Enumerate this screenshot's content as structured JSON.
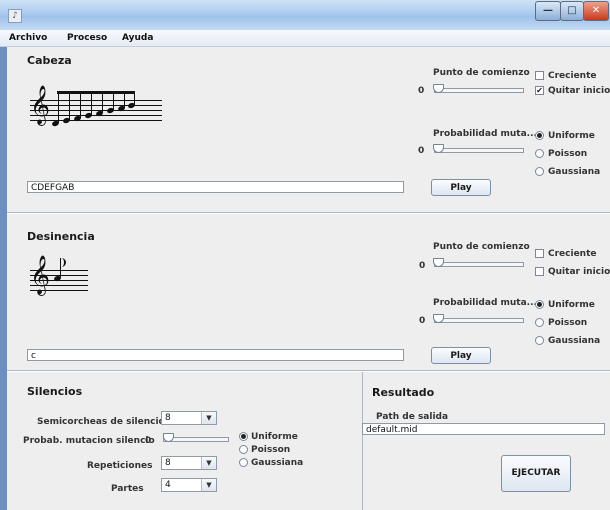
{
  "window": {
    "minimize": "—",
    "maximize": "□",
    "close": "✕",
    "app_icon": "window-app-icon"
  },
  "menu": [
    "Archivo",
    "Proceso",
    "Ayuda"
  ],
  "cabeza": {
    "title": "Cabeza",
    "punto_label": "Punto de comienzo",
    "punto_value": "0",
    "prob_label": "Probabilidad muta...",
    "prob_value": "0",
    "creciente": "Creciente",
    "quitar_inicio": "Quitar inicio",
    "creciente_checked": false,
    "quitar_inicio_checked": true,
    "dist": [
      "Uniforme",
      "Poisson",
      "Gaussiana"
    ],
    "dist_selected": "Uniforme",
    "notes_field": "CDEFGAB",
    "play": "Play"
  },
  "desinencia": {
    "title": "Desinencia",
    "punto_label": "Punto de comienzo",
    "punto_value": "0",
    "prob_label": "Probabilidad muta...",
    "prob_value": "0",
    "creciente": "Creciente",
    "quitar_inicio": "Quitar inicio",
    "creciente_checked": false,
    "quitar_inicio_checked": false,
    "dist": [
      "Uniforme",
      "Poisson",
      "Gaussiana"
    ],
    "dist_selected": "Uniforme",
    "notes_field": "c",
    "play": "Play"
  },
  "silencios": {
    "title": "Silencios",
    "semicorcheas_label": "Semicorcheas de silencio",
    "semicorcheas_value": "8",
    "prob_label": "Probab. mutacion silencio",
    "prob_value": "0",
    "dist": [
      "Uniforme",
      "Poisson",
      "Gaussiana"
    ],
    "dist_selected": "Uniforme",
    "repeticiones_label": "Repeticiones",
    "repeticiones_value": "8",
    "partes_label": "Partes",
    "partes_value": "4"
  },
  "resultado": {
    "title": "Resultado",
    "path_label": "Path de salida",
    "path_value": "default.mid",
    "ejecutar": "EJECUTAR"
  },
  "colors": {
    "panel": "#eeeeee",
    "titlebar": "#aacbee",
    "accent": "#7d8fa5"
  }
}
